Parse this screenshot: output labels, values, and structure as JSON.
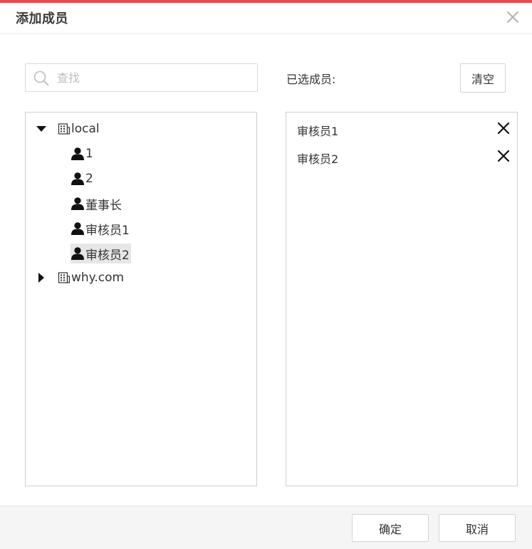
{
  "dialog": {
    "title": "添加成员"
  },
  "search": {
    "placeholder": "查找",
    "value": ""
  },
  "selected": {
    "label": "已选成员:",
    "clear_label": "清空",
    "items": [
      {
        "label": "审核员1"
      },
      {
        "label": "审核员2"
      }
    ]
  },
  "tree": {
    "groups": [
      {
        "label": "local",
        "expanded": true,
        "members": [
          {
            "label": "1"
          },
          {
            "label": "2"
          },
          {
            "label": "董事长"
          },
          {
            "label": "审核员1"
          },
          {
            "label": "审核员2",
            "selected": true
          }
        ]
      },
      {
        "label": "why.com",
        "expanded": false,
        "members": []
      }
    ]
  },
  "footer": {
    "confirm_label": "确定",
    "cancel_label": "取消"
  },
  "colors": {
    "accent": "#e8474d",
    "selected_row": "#e6e6e6",
    "border": "#cfcfcf",
    "footer_bg": "#f5f5f5"
  },
  "icons": [
    "close-icon",
    "search-icon",
    "caret-down-icon",
    "caret-right-icon",
    "building-icon",
    "user-icon",
    "remove-icon"
  ]
}
